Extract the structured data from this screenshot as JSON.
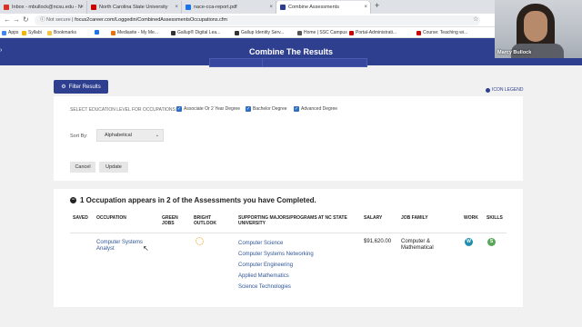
{
  "browser": {
    "tabs": [
      {
        "label": "Inbox - mbullock@ncsu.edu - N",
        "fav_color": "#d93025"
      },
      {
        "label": "North Carolina State University",
        "fav_color": "#c00"
      },
      {
        "label": "nace-cca-report.pdf",
        "fav_color": "#1a73e8"
      },
      {
        "label": "Combine Assessments",
        "fav_color": "#2f3f8f"
      }
    ],
    "new_tab": "+",
    "secure_label": "Not secure",
    "url": "focus2career.com/Loggedin/CombinedAssessmentsOccupations.cfm",
    "bookmarks": [
      "Apps",
      "Syllabi",
      "Bookmarks",
      "",
      "Mediasite - My Me...",
      "Gallup® Digital Lea...",
      "Gallup Identity Serv...",
      "Home | SSC Campus",
      "Portal-Administrati...",
      "Course: Teaching wi..."
    ]
  },
  "header": {
    "title": "Combine The Results"
  },
  "webcam": {
    "name": "Marcy Bullock"
  },
  "filters": {
    "filter_button": "Filter Results",
    "icon_legend": "ICON LEGEND",
    "education_label": "SELECT EDUCATION LEVEL FOR OCCUPATIONS:",
    "education_options": [
      {
        "label": "Associate Or 2 Year Degree",
        "checked": true
      },
      {
        "label": "Bachelor Degree",
        "checked": true
      },
      {
        "label": "Advanced Degree",
        "checked": true
      }
    ],
    "sort_label": "Sort By:",
    "sort_value": "Alphabetical",
    "cancel": "Cancel",
    "update": "Update"
  },
  "results": {
    "heading": "1 Occupation appears in 2 of the Assessments you have Completed.",
    "columns": [
      "SAVED",
      "OCCUPATION",
      "GREEN JOBS",
      "BRIGHT OUTLOOK",
      "SUPPORTING MAJORS/PROGRAMS AT NC STATE UNIVERSITY",
      "SALARY",
      "JOB FAMILY",
      "WORK",
      "SKILLS"
    ],
    "row": {
      "occupation": "Computer Systems Analyst",
      "majors": [
        "Computer Science",
        "Computer Systems Networking",
        "Computer Engineering",
        "Applied Mathematics",
        "Science Technologies"
      ],
      "salary": "$91,620.00",
      "job_family": "Computer & Mathematical",
      "work_badge": "W",
      "skills_badge": "S",
      "work_color": "#1f8fb0",
      "skills_color": "#5aa75a"
    }
  }
}
